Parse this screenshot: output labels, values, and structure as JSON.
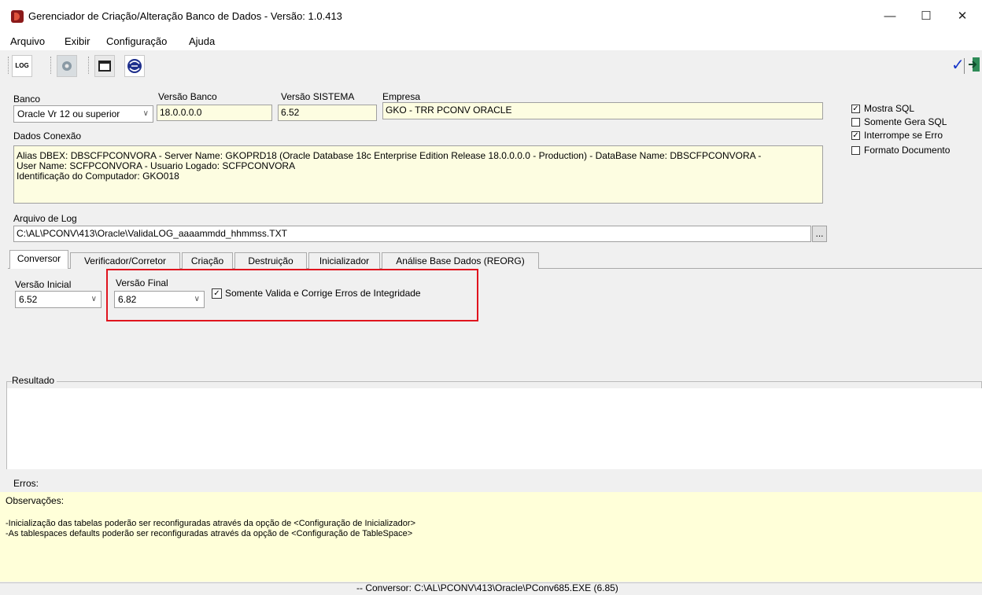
{
  "window": {
    "title": "Gerenciador de Criação/Alteração Banco de Dados - Versão: 1.0.413"
  },
  "menu": [
    "Arquivo",
    "Exibir",
    "Configuração",
    "Ajuda"
  ],
  "toolbar": {
    "log_label": "LOG"
  },
  "banco": {
    "label": "Banco",
    "value": "Oracle Vr 12 ou superior"
  },
  "versao_banco": {
    "label": "Versão Banco",
    "value": "18.0.0.0.0"
  },
  "versao_sistema": {
    "label": "Versão SISTEMA",
    "value": "6.52"
  },
  "empresa": {
    "label": "Empresa",
    "value": "GKO - TRR PCONV ORACLE"
  },
  "options": [
    {
      "label": "Mostra SQL",
      "checked": true
    },
    {
      "label": "Somente Gera SQL",
      "checked": false
    },
    {
      "label": "Interrompe se Erro",
      "checked": true
    },
    {
      "label": "Formato Documento",
      "checked": false
    }
  ],
  "dados_conexao": {
    "label": "Dados Conexão",
    "line1": "Alias DBEX: DBSCFPCONVORA - Server Name: GKOPRD18 (Oracle Database 18c Enterprise Edition Release 18.0.0.0.0 - Production) - DataBase Name: DBSCFPCONVORA -",
    "line2": "User Name: SCFPCONVORA - Usuario Logado: SCFPCONVORA",
    "line3": "Identificação do Computador: GKO018"
  },
  "arquivo_log": {
    "label": "Arquivo de Log",
    "value": "C:\\AL\\PCONV\\413\\Oracle\\ValidaLOG_aaaammdd_hhmmss.TXT",
    "browse": "..."
  },
  "tabs": [
    "Conversor",
    "Verificador/Corretor",
    "Criação",
    "Destruição",
    "Inicializador",
    "Análise Base Dados (REORG)"
  ],
  "conversor": {
    "versao_inicial": {
      "label": "Versão Inicial",
      "value": "6.52"
    },
    "versao_final": {
      "label": "Versão Final",
      "value": "6.82"
    },
    "somente_valida": {
      "label": "Somente Valida e Corrige Erros de Integridade",
      "checked": true
    }
  },
  "resultado": {
    "label": "Resultado"
  },
  "erros": {
    "label": "Erros:"
  },
  "observacoes": {
    "label": "Observações:",
    "line1": "-Inicialização das tabelas poderão ser reconfiguradas através da opção de <Configuração de Inicializador>",
    "line2": "-As tablespaces defaults poderão ser reconfiguradas através da opção de <Configuração de TableSpace>"
  },
  "statusbar": {
    "text": "-- Conversor: C:\\AL\\PCONV\\413\\Oracle\\PConv685.EXE (6.85)"
  },
  "colors": {
    "highlight": "#e0141e",
    "field_bg": "#fdfde1",
    "obs_bg": "#ffffd9"
  }
}
